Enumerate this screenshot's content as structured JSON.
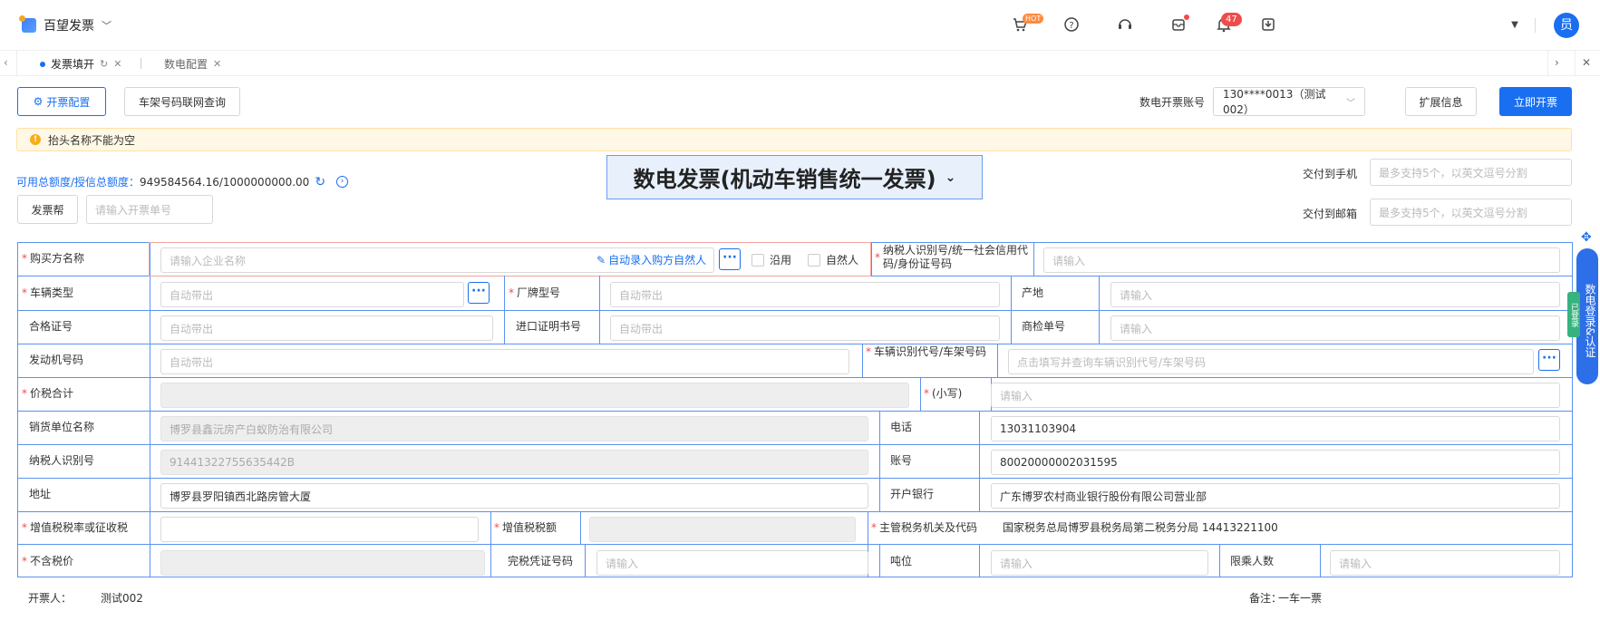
{
  "app": {
    "name": "百望发票"
  },
  "header": {
    "hot_badge": "HOT",
    "notification_count": "47",
    "avatar": "员"
  },
  "tabs": [
    {
      "label": "发票填开",
      "active": true
    },
    {
      "label": "数电配置",
      "active": false
    }
  ],
  "toolbar": {
    "config_btn": "开票配置",
    "vin_query_btn": "车架号码联网查询",
    "account_label": "数电开票账号",
    "account_value": "130****0013（测试002）",
    "ext_btn": "扩展信息",
    "issue_btn": "立即开票"
  },
  "alert": {
    "text": "抬头名称不能为空"
  },
  "quota": {
    "label": "可用总额度/授信总额度：",
    "value": "949584564.16/1000000000.00"
  },
  "helper": {
    "btn": "发票帮",
    "input_placeholder": "请输入开票单号"
  },
  "invoice_title": "数电发票(机动车销售统一发票)",
  "delivery": {
    "phone_label": "交付到手机",
    "phone_placeholder": "最多支持5个，以英文逗号分割",
    "email_label": "交付到邮箱",
    "email_placeholder": "最多支持5个，以英文逗号分割"
  },
  "form": {
    "buyer_name": {
      "label": "购买方名称",
      "placeholder": "请输入企业名称",
      "auto_link": "自动录入购方自然人",
      "reuse": "沿用",
      "natural": "自然人"
    },
    "taxid": {
      "label": "纳税人识别号/统一社会信用代码/身份证号码",
      "placeholder": "请输入"
    },
    "vehicle_type": {
      "label": "车辆类型",
      "placeholder": "自动带出"
    },
    "brand_model": {
      "label": "厂牌型号",
      "placeholder": "自动带出"
    },
    "origin": {
      "label": "产地",
      "placeholder": "请输入"
    },
    "cert_no": {
      "label": "合格证号",
      "placeholder": "自动带出"
    },
    "import_cert": {
      "label": "进口证明书号",
      "placeholder": "自动带出"
    },
    "inspection": {
      "label": "商检单号",
      "placeholder": "请输入"
    },
    "engine_no": {
      "label": "发动机号码",
      "placeholder": "自动带出"
    },
    "vin": {
      "label": "车辆识别代号/车架号码",
      "placeholder": "点击填写并查询车辆识别代号/车架号码"
    },
    "total": {
      "label": "价税合计",
      "small_label": "(小写)",
      "small_placeholder": "请输入"
    },
    "seller_name": {
      "label": "销货单位名称",
      "value": "博罗县鑫沅房产白蚁防治有限公司"
    },
    "phone": {
      "label": "电话",
      "value": "13031103904"
    },
    "seller_taxid": {
      "label": "纳税人识别号",
      "value": "91441322755635442B"
    },
    "account": {
      "label": "账号",
      "value": "80020000002031595"
    },
    "address": {
      "label": "地址",
      "value": "博罗县罗阳镇西北路房管大厦"
    },
    "bank": {
      "label": "开户银行",
      "value": "广东博罗农村商业银行股份有限公司营业部"
    },
    "vat_rate": {
      "label": "增值税税率或征收税"
    },
    "vat_amount": {
      "label": "增值税税额"
    },
    "tax_authority": {
      "label": "主管税务机关及代码",
      "value": "国家税务总局博罗县税务局第二税务分局 14413221100"
    },
    "net_price": {
      "label": "不含税价"
    },
    "tax_cert": {
      "label": "完税凭证号码",
      "placeholder": "请输入"
    },
    "tonnage": {
      "label": "吨位",
      "placeholder": "请输入"
    },
    "passengers": {
      "label": "限乘人数",
      "placeholder": "请输入"
    }
  },
  "footer": {
    "issuer_label": "开票人：",
    "issuer": "测试002",
    "remark_label": "备注：",
    "remark": "一车一票"
  },
  "side": {
    "panel": "数电登录&认证",
    "tag": "已登录"
  }
}
